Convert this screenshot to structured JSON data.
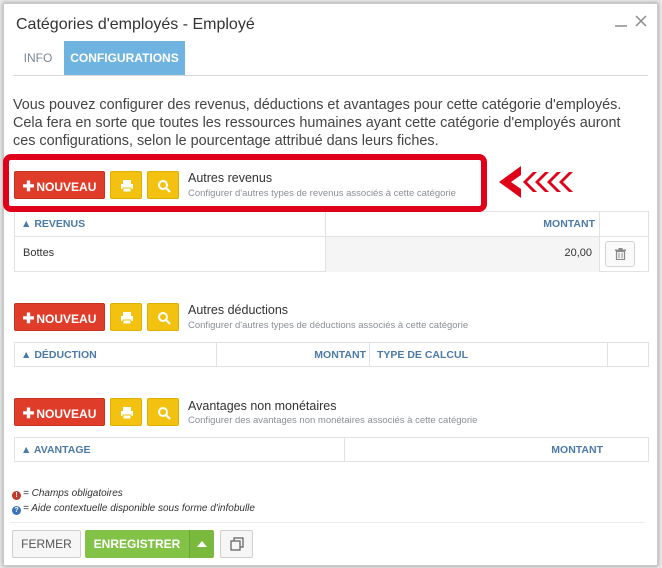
{
  "window": {
    "title": "Catégories d'employés - Employé"
  },
  "tabs": [
    {
      "label": "INFO"
    },
    {
      "label": "CONFIGURATIONS"
    }
  ],
  "intro_text": "Vous pouvez configurer des revenus, déductions et avantages pour cette catégorie d'employés. Cela fera en sorte que toutes les ressources humaines ayant cette catégorie d'employés auront ces configurations, selon le pourcentage attribué dans leurs fiches.",
  "sections": {
    "revenus": {
      "new_label": "NOUVEAU",
      "title": "Autres revenus",
      "subtitle": "Configurer d'autres types de revenus associés à cette catégorie",
      "columns": [
        "REVENUS",
        "MONTANT"
      ],
      "rows": [
        {
          "name": "Bottes",
          "amount": "20,00"
        }
      ]
    },
    "deductions": {
      "new_label": "NOUVEAU",
      "title": "Autres déductions",
      "subtitle": "Configurer d'autres types de déductions associés à cette catégorie",
      "columns": [
        "DÉDUCTION",
        "MONTANT",
        "TYPE DE CALCUL"
      ]
    },
    "avantages": {
      "new_label": "NOUVEAU",
      "title": "Avantages non monétaires",
      "subtitle": "Configurer des avantages non monétaires associés à cette catégorie",
      "columns": [
        "AVANTAGE",
        "MONTANT"
      ]
    }
  },
  "legend": {
    "required": "= Champs obligatoires",
    "help": "= Aide contextuelle disponible sous forme d'infobulle"
  },
  "footer": {
    "close_label": "FERMER",
    "save_label": "ENREGISTRER"
  },
  "colors": {
    "danger": "#e03c2a",
    "warning": "#f3c211",
    "success": "#82c247",
    "tab_active": "#6fb3e0",
    "highlight": "#e1001a"
  }
}
